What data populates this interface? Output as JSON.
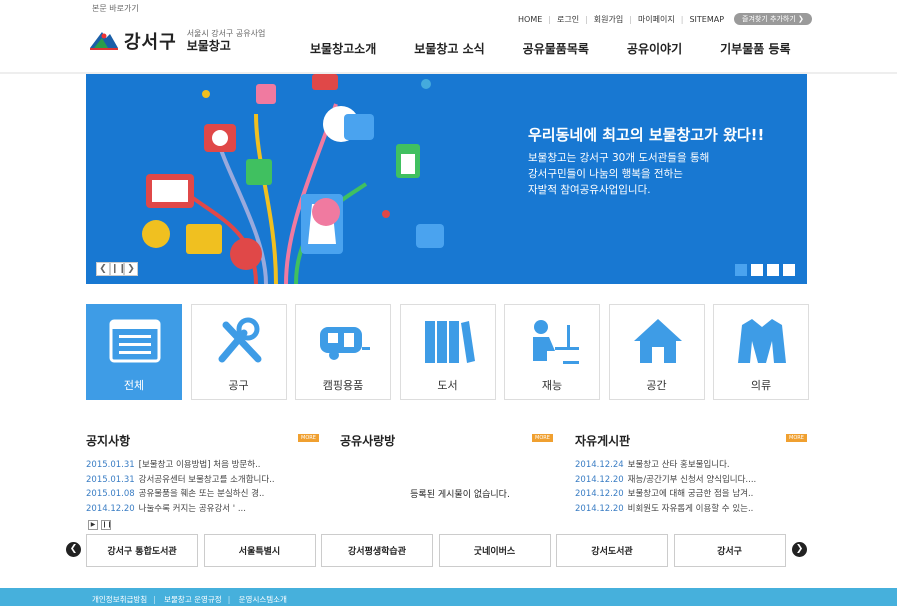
{
  "skip_link": "본문 바로가기",
  "util": {
    "links": [
      "HOME",
      "로그인",
      "회원가입",
      "마이페이지",
      "SITEMAP"
    ],
    "favorite": "즐겨찾기 추가하기 ❯"
  },
  "logo": {
    "name": "강서구",
    "sub1": "서울시 강서구 공유사업",
    "sub2": "보물창고"
  },
  "gnb": [
    "보물창고소개",
    "보물창고 소식",
    "공유물품목록",
    "공유이야기",
    "기부물품 등록"
  ],
  "hero": {
    "title": "우리동네에 최고의 보물창고가 왔다!!",
    "desc1": "보물창고는 강서구 30개 도서관들을 통해",
    "desc2": "강서구민들이 나눔의 행복을 전하는",
    "desc3": "자발적 참여공유사업입니다.",
    "controls": [
      "❮",
      "❙❙",
      "❯"
    ],
    "slide_count": 4,
    "active_slide": 1
  },
  "categories": [
    {
      "label": "전체",
      "icon": "list-window-icon"
    },
    {
      "label": "공구",
      "icon": "tools-icon"
    },
    {
      "label": "캠핑용품",
      "icon": "camping-trailer-icon"
    },
    {
      "label": "도서",
      "icon": "books-icon"
    },
    {
      "label": "재능",
      "icon": "person-desk-icon"
    },
    {
      "label": "공간",
      "icon": "house-icon"
    },
    {
      "label": "의류",
      "icon": "jacket-icon"
    }
  ],
  "boards": {
    "notice": {
      "title": "공지사항",
      "more": "MORE",
      "items": [
        {
          "date": "2015.01.31",
          "text": "[보물창고 이용방법] 처음 방문하.."
        },
        {
          "date": "2015.01.31",
          "text": "강서공유센터 보물창고를 소개합니다.."
        },
        {
          "date": "2015.01.08",
          "text": "공유물품을 훼손 또는 분실하신 경.."
        },
        {
          "date": "2014.12.20",
          "text": "나눌수록 커지는 공유강서 ' ..."
        }
      ]
    },
    "share": {
      "title": "공유사랑방",
      "more": "MORE",
      "empty": "등록된 게시물이 없습니다."
    },
    "free": {
      "title": "자유게시판",
      "more": "MORE",
      "items": [
        {
          "date": "2014.12.24",
          "text": "보물창고 산타 홍보물입니다."
        },
        {
          "date": "2014.12.20",
          "text": "재능/공간기부 신청서 양식입니다...."
        },
        {
          "date": "2014.12.20",
          "text": "보물창고에 대해 궁금한 점을 남겨.."
        },
        {
          "date": "2014.12.20",
          "text": "비회원도 자유롭게 이용할 수 있는.."
        }
      ]
    }
  },
  "banner_controls": [
    "▶",
    "❙❙"
  ],
  "banners": [
    "강서구 통합도서관",
    "서울특별시",
    "강서평생학습관",
    "굿네이버스",
    "강서도서관",
    "강서구"
  ],
  "footer": [
    "개인정보취급방침",
    "보물창고 운영규정",
    "운영시스템소개"
  ],
  "colors": {
    "primary": "#1878d2",
    "active_tile": "#3e9ce6",
    "footer": "#46b0dc",
    "more_badge": "#f0a030"
  }
}
